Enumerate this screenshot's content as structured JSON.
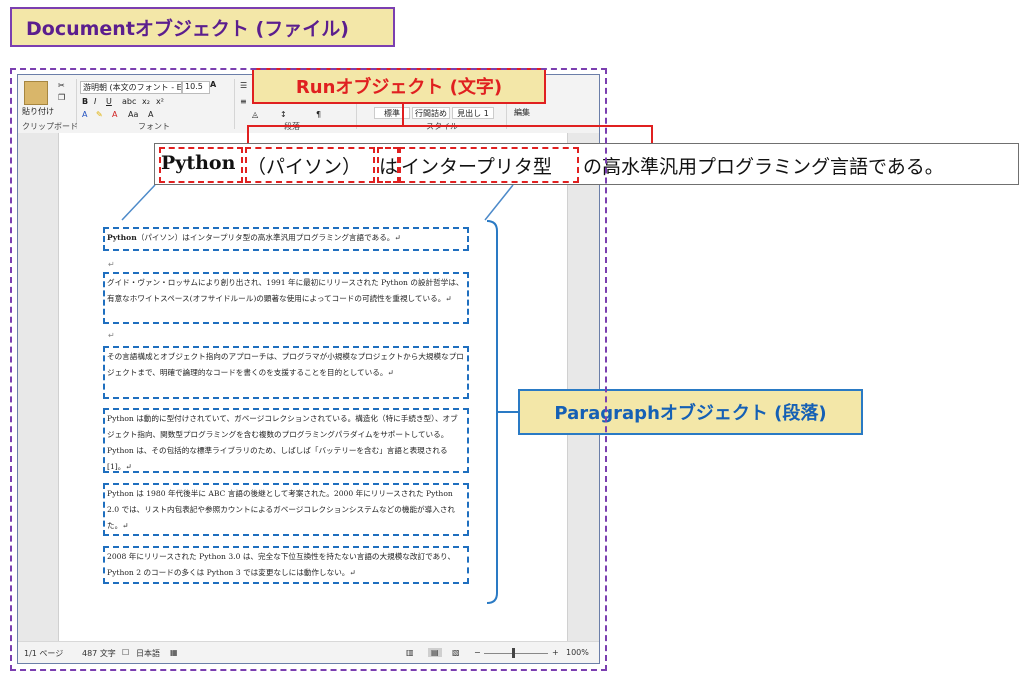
{
  "labels": {
    "document": "Documentオブジェクト (ファイル)",
    "run": "Runオブジェクト (文字)",
    "paragraph": "Paragraphオブジェクト (段落)"
  },
  "ribbon": {
    "paste": "貼り付け",
    "font_name": "游明朝 (本文のフォント - E",
    "font_size": "10.5",
    "bold": "B",
    "italic": "I",
    "underline": "U",
    "group_clipboard": "クリップボード",
    "group_font": "フォント",
    "group_paragraph": "段落",
    "group_style": "スタイル",
    "style_1": "標準",
    "style_2": "行間詰め",
    "style_3": "見出し 1",
    "edit": "編集"
  },
  "callout": {
    "run1": "Python",
    "run2": "（パイソン）",
    "run3": "は",
    "run4": "インタープリタ型",
    "rest": "の高水準汎用プログラミング言語である。"
  },
  "document": {
    "paragraphs": [
      {
        "lead": "Python",
        "text": "（パイソン）はインタープリタ型の高水準汎用プログラミング言語である。↵"
      },
      {
        "lead": "",
        "text": "グイド・ヴァン・ロッサムにより創り出され、1991 年に最初にリリースされた Python の設計哲学は、有意なホワイトスペース(オフサイドルール)の顕著な使用によってコードの可読性を重視している。↵"
      },
      {
        "lead": "",
        "text": "その言語構成とオブジェクト指向のアプローチは、プログラマが小規模なプロジェクトから大規模なプロジェクトまで、明確で論理的なコードを書くのを支援することを目的としている。↵"
      },
      {
        "lead": "",
        "text": "Python は動的に型付けされていて、ガベージコレクションされている。構造化（特に手続き型）、オブジェクト指向、関数型プログラミングを含む複数のプログラミングパラダイムをサポートしている。Python は、その包括的な標準ライブラリのため、しばしば「バッテリーを含む」言語と表現される[1]。↵"
      },
      {
        "lead": "",
        "text": "Python は 1980 年代後半に ABC 言語の後継として考案された。2000 年にリリースされた Python 2.0 では、リスト内包表記や参照カウントによるガベージコレクションシステムなどの機能が導入された。↵"
      },
      {
        "lead": "",
        "text": "2008 年にリリースされた Python 3.0 は、完全な下位互換性を持たない言語の大規模な改訂であり、Python 2 のコードの多くは Python 3 では変更なしには動作しない。↵"
      }
    ]
  },
  "status": {
    "page": "1/1 ページ",
    "words": "487 文字",
    "lang": "日本語",
    "zoom": "100%"
  }
}
